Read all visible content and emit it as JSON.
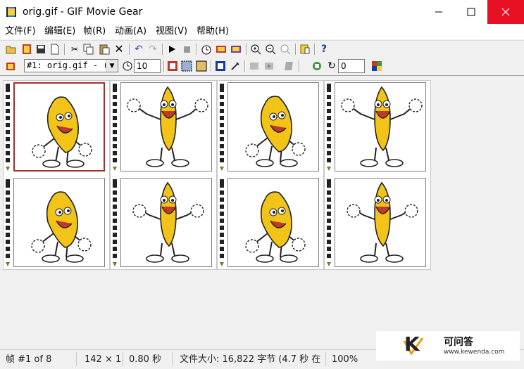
{
  "window": {
    "title": "orig.gif - GIF Movie Gear"
  },
  "menu": [
    "文件(F)",
    "编辑(E)",
    "帧(R)",
    "动画(A)",
    "视图(V)",
    "帮助(H)"
  ],
  "toolbar": {
    "frame_select_value": "#1: orig.gif - (",
    "delay_value": "10",
    "loop_value": "0",
    "help_label": "?"
  },
  "frames": [
    {
      "pose": "lean-right"
    },
    {
      "pose": "arms-up"
    },
    {
      "pose": "lean-right"
    },
    {
      "pose": "arms-up"
    },
    {
      "pose": "lean-right"
    },
    {
      "pose": "arms-mid"
    },
    {
      "pose": "lean-right"
    },
    {
      "pose": "arms-mid"
    }
  ],
  "status": {
    "frame": "帧 #1 of 8",
    "size": "142 × 1",
    "duration": "0.80 秒",
    "filesize": "文件大小: 16,822 字节  (4.7 秒 在",
    "zoom": "100%"
  },
  "watermark": {
    "logo": "K",
    "name": "可问答",
    "url": "www.kewenda.com"
  },
  "colors": {
    "close_button": "#e81123",
    "selected_frame": "#a33030",
    "banana": "#f2c418"
  }
}
